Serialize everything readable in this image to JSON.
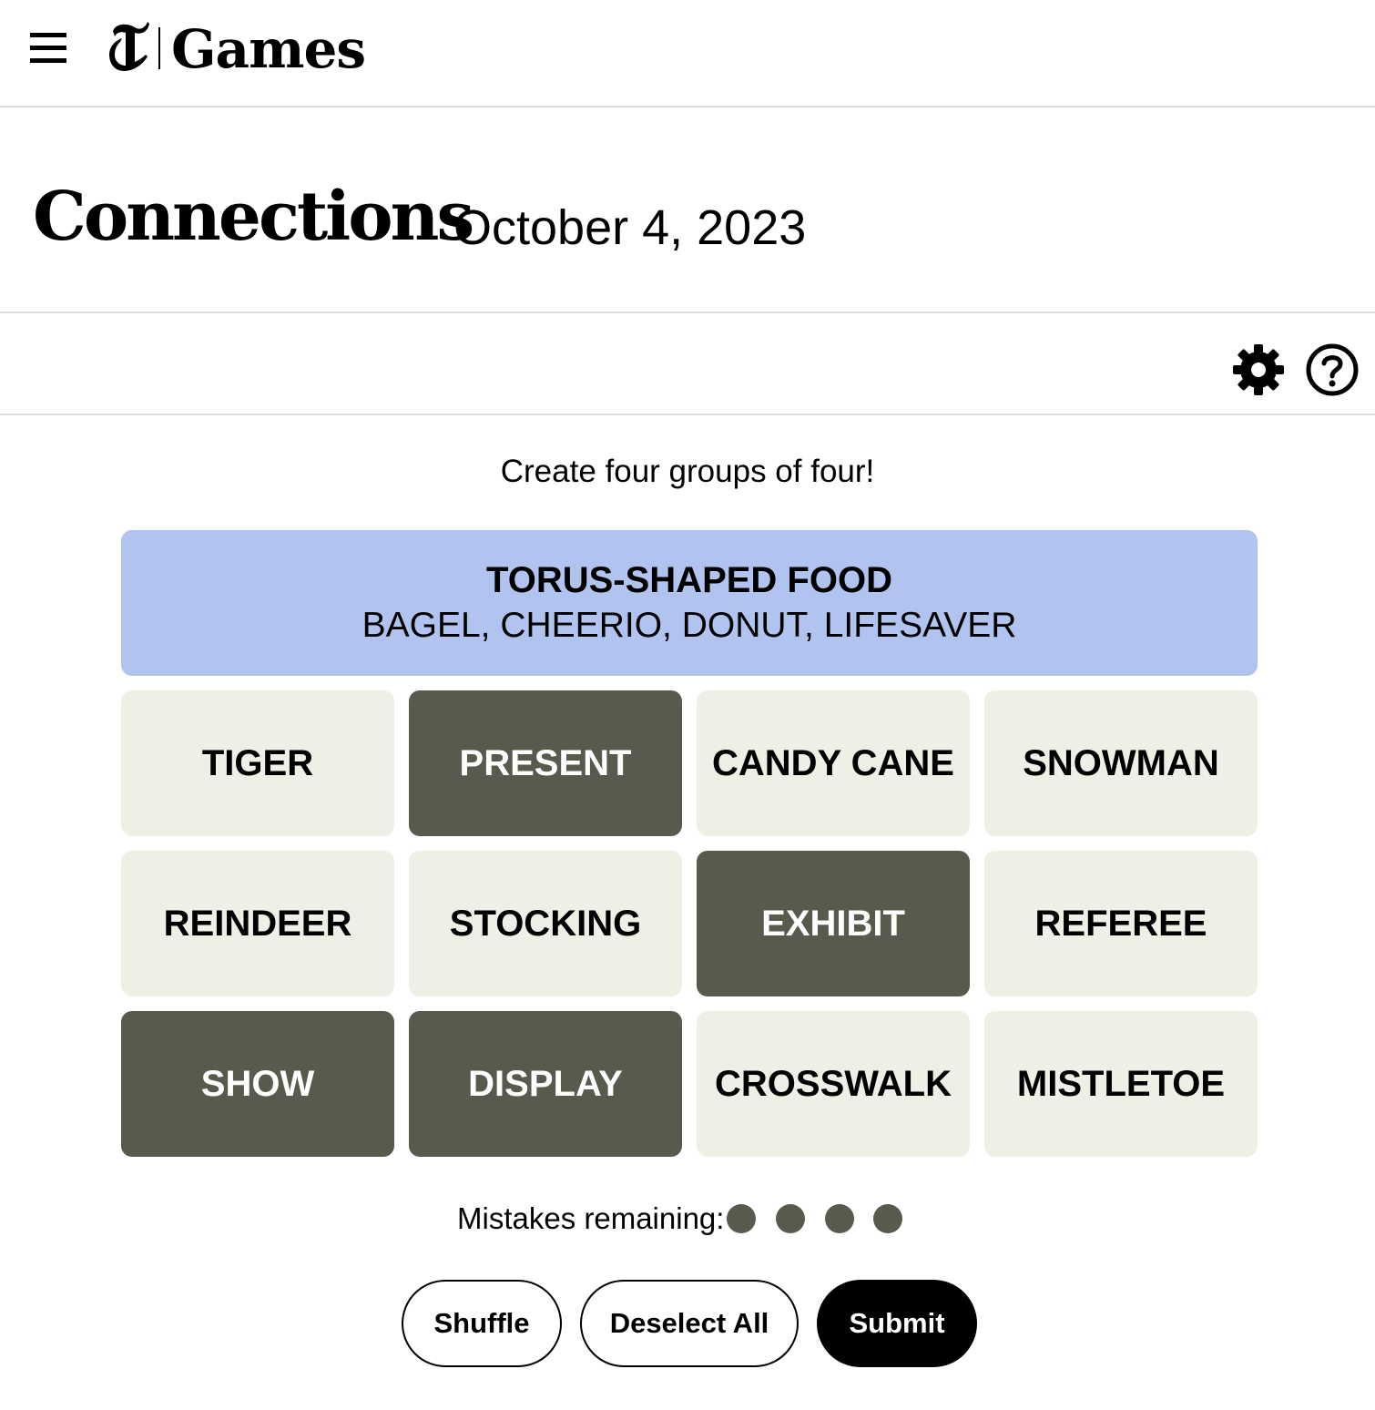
{
  "header": {
    "menu_icon": "hamburger-menu-icon",
    "brand_logo_icon": "nyt-t-logo-icon",
    "brand_label": "Games"
  },
  "page": {
    "title": "Connections",
    "date": "October 4, 2023"
  },
  "toolbar": {
    "settings_icon": "gear-icon",
    "help_icon": "question-circle-icon"
  },
  "instructions": "Create four groups of four!",
  "solved_groups": [
    {
      "title": "TORUS-SHAPED FOOD",
      "members": "BAGEL, CHEERIO, DONUT, LIFESAVER",
      "color": "#b0c4ef"
    }
  ],
  "tiles": [
    {
      "label": "TIGER",
      "selected": false
    },
    {
      "label": "PRESENT",
      "selected": true
    },
    {
      "label": "CANDY CANE",
      "selected": false
    },
    {
      "label": "SNOWMAN",
      "selected": false
    },
    {
      "label": "REINDEER",
      "selected": false
    },
    {
      "label": "STOCKING",
      "selected": false
    },
    {
      "label": "EXHIBIT",
      "selected": true
    },
    {
      "label": "REFEREE",
      "selected": false
    },
    {
      "label": "SHOW",
      "selected": true
    },
    {
      "label": "DISPLAY",
      "selected": true
    },
    {
      "label": "CROSSWALK",
      "selected": false
    },
    {
      "label": "MISTLETOE",
      "selected": false
    }
  ],
  "mistakes": {
    "label": "Mistakes remaining:",
    "remaining": 4
  },
  "actions": {
    "shuffle_label": "Shuffle",
    "deselect_label": "Deselect All",
    "submit_label": "Submit"
  },
  "colors": {
    "tile_default": "#efefe6",
    "tile_selected": "#5a594e",
    "text_default": "#000000",
    "text_selected": "#ffffff",
    "dot": "#5a594e"
  }
}
